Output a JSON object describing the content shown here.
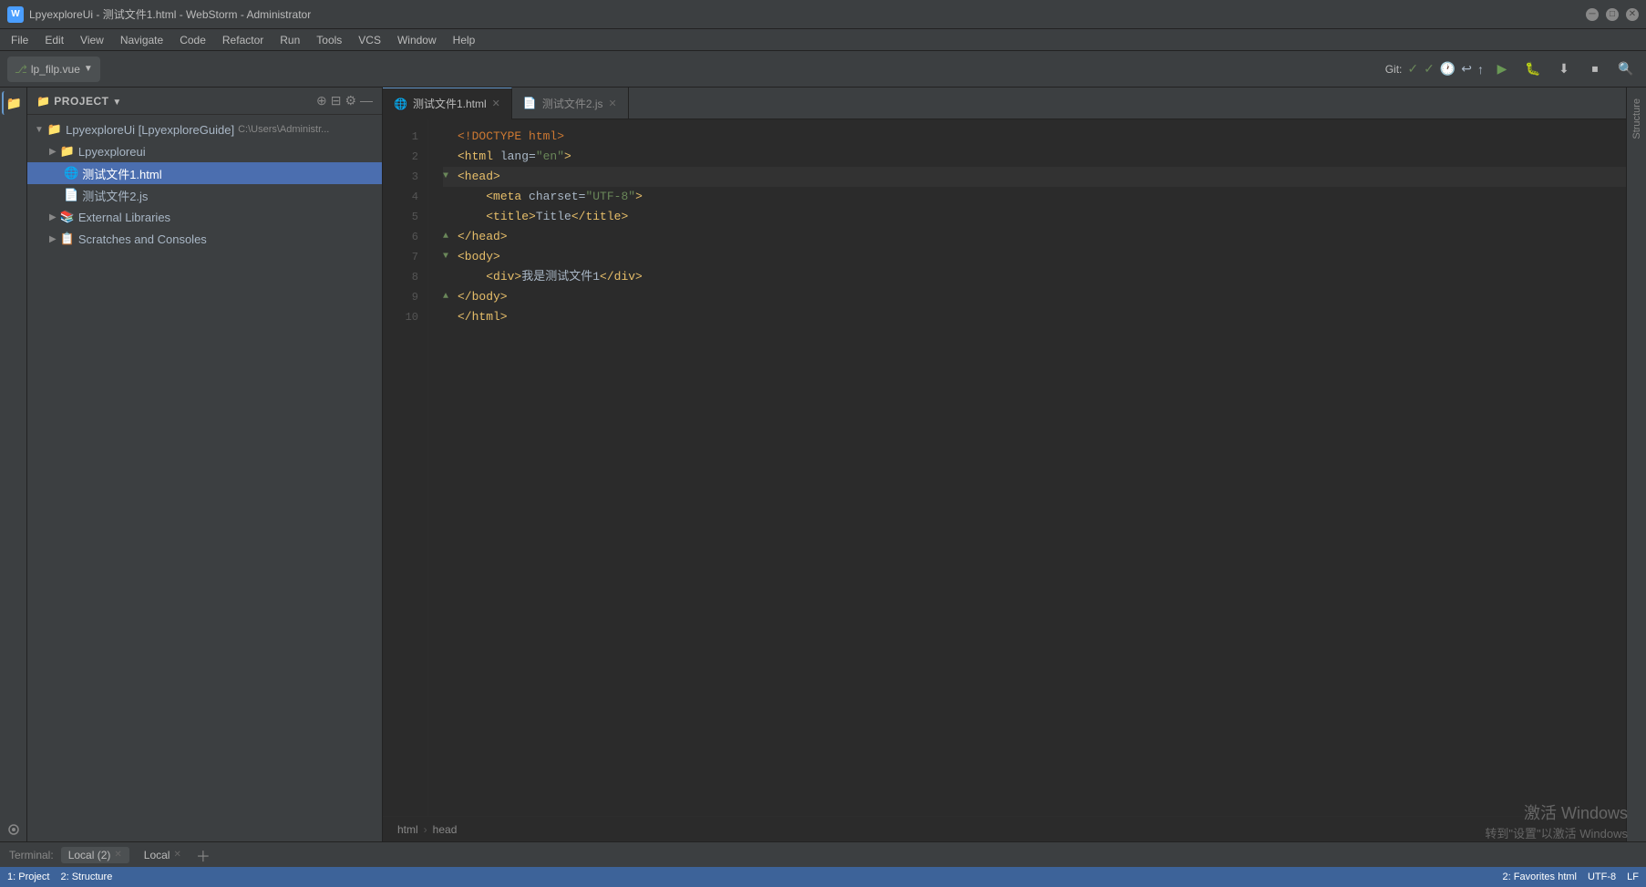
{
  "window": {
    "title": "LpyexploreUi - 测试文件1.html - WebStorm - Administrator",
    "logo_text": "W"
  },
  "menu": {
    "items": [
      "File",
      "Edit",
      "View",
      "Navigate",
      "Code",
      "Refactor",
      "Run",
      "Tools",
      "VCS",
      "Window",
      "Help"
    ]
  },
  "toolbar": {
    "branch": "lp_filp.vue",
    "git_label": "Git:",
    "buttons": [
      "▶",
      "🐛",
      "⬇",
      "⏹"
    ]
  },
  "sidebar": {
    "title": "Project",
    "root": "LpyexploreUi [LpyexploreGuide]",
    "root_path": "C:\\Users\\Administr...",
    "items": [
      {
        "name": "Lpyexploreui",
        "type": "folder",
        "level": 1,
        "expanded": false
      },
      {
        "name": "测试文件1.html",
        "type": "html",
        "level": 2,
        "selected": true
      },
      {
        "name": "测试文件2.js",
        "type": "js",
        "level": 2,
        "selected": false
      },
      {
        "name": "External Libraries",
        "type": "lib",
        "level": 1
      },
      {
        "name": "Scratches and Consoles",
        "type": "scratch",
        "level": 1
      }
    ]
  },
  "tabs": [
    {
      "name": "测试文件1.html",
      "type": "html",
      "active": true
    },
    {
      "name": "测试文件2.js",
      "type": "js",
      "active": false
    }
  ],
  "code": {
    "lines": [
      {
        "num": 1,
        "content": "<!DOCTYPE html>",
        "tokens": [
          {
            "type": "kw",
            "text": "<!DOCTYPE html>"
          }
        ]
      },
      {
        "num": 2,
        "content": "<html lang=\"en\">",
        "tokens": [
          {
            "type": "tag",
            "text": "<html"
          },
          {
            "type": "attr",
            "text": " lang"
          },
          {
            "type": "txt",
            "text": "="
          },
          {
            "type": "val",
            "text": "\"en\""
          },
          {
            "type": "tag",
            "text": ">"
          }
        ]
      },
      {
        "num": 3,
        "content": "<head>",
        "highlighted": true,
        "tokens": [
          {
            "type": "tag",
            "text": "<head>"
          }
        ]
      },
      {
        "num": 4,
        "content": "    <meta charset=\"UTF-8\">",
        "tokens": [
          {
            "type": "txt",
            "text": "    "
          },
          {
            "type": "tag",
            "text": "<meta"
          },
          {
            "type": "attr",
            "text": " charset"
          },
          {
            "type": "txt",
            "text": "="
          },
          {
            "type": "val",
            "text": "\"UTF-8\""
          },
          {
            "type": "tag",
            "text": ">"
          }
        ]
      },
      {
        "num": 5,
        "content": "    <title>Title</title>",
        "tokens": [
          {
            "type": "txt",
            "text": "    "
          },
          {
            "type": "tag",
            "text": "<title>"
          },
          {
            "type": "txt",
            "text": "Title"
          },
          {
            "type": "tag",
            "text": "</title>"
          }
        ]
      },
      {
        "num": 6,
        "content": "</head>",
        "tokens": [
          {
            "type": "tag",
            "text": "</head>"
          }
        ]
      },
      {
        "num": 7,
        "content": "<body>",
        "tokens": [
          {
            "type": "tag",
            "text": "<body>"
          }
        ]
      },
      {
        "num": 8,
        "content": "    <div>我是测试文件1</div>",
        "tokens": [
          {
            "type": "txt",
            "text": "    "
          },
          {
            "type": "tag",
            "text": "<div>"
          },
          {
            "type": "txt",
            "text": "我是测试文件1"
          },
          {
            "type": "tag",
            "text": "</div>"
          }
        ]
      },
      {
        "num": 9,
        "content": "</body>",
        "tokens": [
          {
            "type": "tag",
            "text": "</body>"
          }
        ]
      },
      {
        "num": 10,
        "content": "</html>",
        "tokens": [
          {
            "type": "tag",
            "text": "</html>"
          }
        ]
      }
    ]
  },
  "breadcrumb": {
    "items": [
      "html",
      "head"
    ]
  },
  "terminal": {
    "label": "Terminal:",
    "tabs": [
      {
        "name": "Local (2)",
        "active": true
      },
      {
        "name": "Local",
        "active": false
      }
    ]
  },
  "status": {
    "left": [
      "1: Project",
      "2: Structure"
    ],
    "right": [
      "html",
      "UTF-8",
      "LF",
      "2: Favorites"
    ]
  },
  "watermark": {
    "line1": "激活 Windows",
    "line2": "转到\"设置\"以激活 Windows"
  },
  "activity": {
    "icons": [
      "📁",
      "🔍",
      "🔀",
      "🕐",
      "⭐"
    ]
  },
  "right_sidebar": {
    "tabs": [
      "Z: Structure",
      "2: Structure"
    ]
  }
}
